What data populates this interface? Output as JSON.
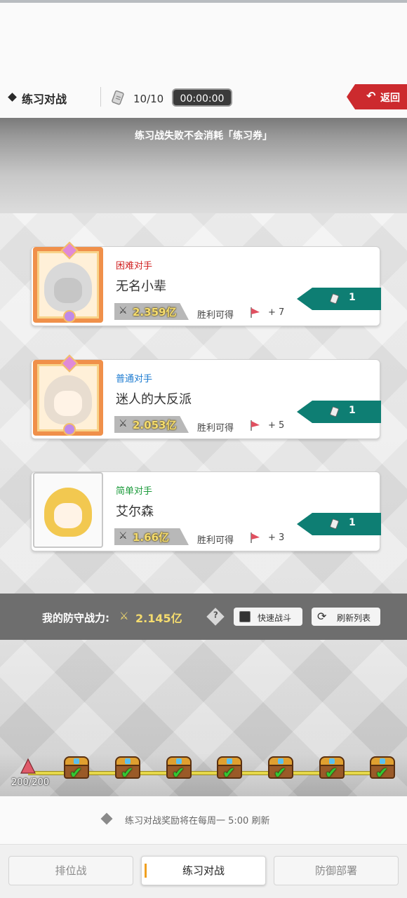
{
  "header": {
    "title": "练习对战",
    "ticket_count": "10/10",
    "timer": "00:00:00",
    "back_label": "返回"
  },
  "notice": "练习战失败不会消耗「练习券」",
  "opponents": [
    {
      "difficulty": "困难对手",
      "difficulty_color": "#d02020",
      "name": "无名小辈",
      "power": "2.359亿",
      "win_label": "胜利可得",
      "reward": "+ 7",
      "cost": "1"
    },
    {
      "difficulty": "普通对手",
      "difficulty_color": "#1a7ad0",
      "name": "迷人的大反派",
      "power": "2.053亿",
      "win_label": "胜利可得",
      "reward": "+ 5",
      "cost": "1"
    },
    {
      "difficulty": "简单对手",
      "difficulty_color": "#1a9a3a",
      "name": "艾尔森",
      "power": "1.66亿",
      "win_label": "胜利可得",
      "reward": "+ 3",
      "cost": "1"
    }
  ],
  "defense": {
    "label": "我的防守战力:",
    "power": "2.145亿",
    "help": "?",
    "quick_battle": "快速战斗",
    "refresh_list": "刷新列表"
  },
  "progress": {
    "count": "200/200",
    "chests_claimed": 7,
    "fraction": 1.0
  },
  "footer_notice": "练习对战奖励将在每周一 5:00 刷新",
  "tabs": [
    {
      "label": "排位战",
      "active": false
    },
    {
      "label": "练习对战",
      "active": true
    },
    {
      "label": "防御部署",
      "active": false
    }
  ],
  "icons": {
    "power": "crossed-swords-icon",
    "flag": "flag-icon",
    "ticket": "ticket-icon",
    "refresh": "refresh-icon",
    "back": "return-arrow-icon"
  }
}
